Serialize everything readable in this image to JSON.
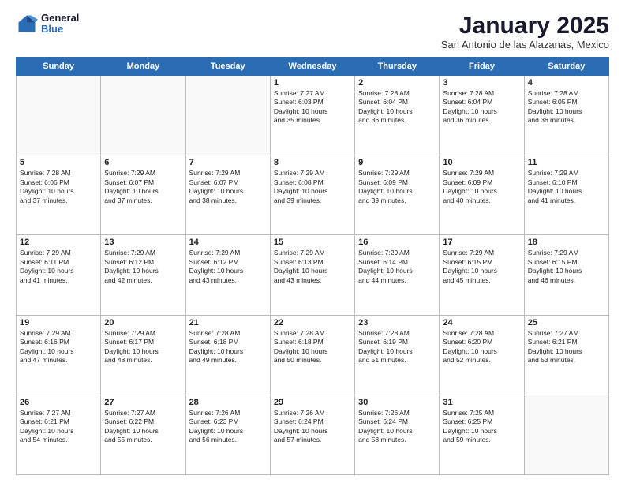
{
  "header": {
    "logo_general": "General",
    "logo_blue": "Blue",
    "month_title": "January 2025",
    "location": "San Antonio de las Alazanas, Mexico"
  },
  "weekdays": [
    "Sunday",
    "Monday",
    "Tuesday",
    "Wednesday",
    "Thursday",
    "Friday",
    "Saturday"
  ],
  "weeks": [
    [
      {
        "day": "",
        "info": ""
      },
      {
        "day": "",
        "info": ""
      },
      {
        "day": "",
        "info": ""
      },
      {
        "day": "1",
        "info": "Sunrise: 7:27 AM\nSunset: 6:03 PM\nDaylight: 10 hours\nand 35 minutes."
      },
      {
        "day": "2",
        "info": "Sunrise: 7:28 AM\nSunset: 6:04 PM\nDaylight: 10 hours\nand 36 minutes."
      },
      {
        "day": "3",
        "info": "Sunrise: 7:28 AM\nSunset: 6:04 PM\nDaylight: 10 hours\nand 36 minutes."
      },
      {
        "day": "4",
        "info": "Sunrise: 7:28 AM\nSunset: 6:05 PM\nDaylight: 10 hours\nand 36 minutes."
      }
    ],
    [
      {
        "day": "5",
        "info": "Sunrise: 7:28 AM\nSunset: 6:06 PM\nDaylight: 10 hours\nand 37 minutes."
      },
      {
        "day": "6",
        "info": "Sunrise: 7:29 AM\nSunset: 6:07 PM\nDaylight: 10 hours\nand 37 minutes."
      },
      {
        "day": "7",
        "info": "Sunrise: 7:29 AM\nSunset: 6:07 PM\nDaylight: 10 hours\nand 38 minutes."
      },
      {
        "day": "8",
        "info": "Sunrise: 7:29 AM\nSunset: 6:08 PM\nDaylight: 10 hours\nand 39 minutes."
      },
      {
        "day": "9",
        "info": "Sunrise: 7:29 AM\nSunset: 6:09 PM\nDaylight: 10 hours\nand 39 minutes."
      },
      {
        "day": "10",
        "info": "Sunrise: 7:29 AM\nSunset: 6:09 PM\nDaylight: 10 hours\nand 40 minutes."
      },
      {
        "day": "11",
        "info": "Sunrise: 7:29 AM\nSunset: 6:10 PM\nDaylight: 10 hours\nand 41 minutes."
      }
    ],
    [
      {
        "day": "12",
        "info": "Sunrise: 7:29 AM\nSunset: 6:11 PM\nDaylight: 10 hours\nand 41 minutes."
      },
      {
        "day": "13",
        "info": "Sunrise: 7:29 AM\nSunset: 6:12 PM\nDaylight: 10 hours\nand 42 minutes."
      },
      {
        "day": "14",
        "info": "Sunrise: 7:29 AM\nSunset: 6:12 PM\nDaylight: 10 hours\nand 43 minutes."
      },
      {
        "day": "15",
        "info": "Sunrise: 7:29 AM\nSunset: 6:13 PM\nDaylight: 10 hours\nand 43 minutes."
      },
      {
        "day": "16",
        "info": "Sunrise: 7:29 AM\nSunset: 6:14 PM\nDaylight: 10 hours\nand 44 minutes."
      },
      {
        "day": "17",
        "info": "Sunrise: 7:29 AM\nSunset: 6:15 PM\nDaylight: 10 hours\nand 45 minutes."
      },
      {
        "day": "18",
        "info": "Sunrise: 7:29 AM\nSunset: 6:15 PM\nDaylight: 10 hours\nand 46 minutes."
      }
    ],
    [
      {
        "day": "19",
        "info": "Sunrise: 7:29 AM\nSunset: 6:16 PM\nDaylight: 10 hours\nand 47 minutes."
      },
      {
        "day": "20",
        "info": "Sunrise: 7:29 AM\nSunset: 6:17 PM\nDaylight: 10 hours\nand 48 minutes."
      },
      {
        "day": "21",
        "info": "Sunrise: 7:28 AM\nSunset: 6:18 PM\nDaylight: 10 hours\nand 49 minutes."
      },
      {
        "day": "22",
        "info": "Sunrise: 7:28 AM\nSunset: 6:18 PM\nDaylight: 10 hours\nand 50 minutes."
      },
      {
        "day": "23",
        "info": "Sunrise: 7:28 AM\nSunset: 6:19 PM\nDaylight: 10 hours\nand 51 minutes."
      },
      {
        "day": "24",
        "info": "Sunrise: 7:28 AM\nSunset: 6:20 PM\nDaylight: 10 hours\nand 52 minutes."
      },
      {
        "day": "25",
        "info": "Sunrise: 7:27 AM\nSunset: 6:21 PM\nDaylight: 10 hours\nand 53 minutes."
      }
    ],
    [
      {
        "day": "26",
        "info": "Sunrise: 7:27 AM\nSunset: 6:21 PM\nDaylight: 10 hours\nand 54 minutes."
      },
      {
        "day": "27",
        "info": "Sunrise: 7:27 AM\nSunset: 6:22 PM\nDaylight: 10 hours\nand 55 minutes."
      },
      {
        "day": "28",
        "info": "Sunrise: 7:26 AM\nSunset: 6:23 PM\nDaylight: 10 hours\nand 56 minutes."
      },
      {
        "day": "29",
        "info": "Sunrise: 7:26 AM\nSunset: 6:24 PM\nDaylight: 10 hours\nand 57 minutes."
      },
      {
        "day": "30",
        "info": "Sunrise: 7:26 AM\nSunset: 6:24 PM\nDaylight: 10 hours\nand 58 minutes."
      },
      {
        "day": "31",
        "info": "Sunrise: 7:25 AM\nSunset: 6:25 PM\nDaylight: 10 hours\nand 59 minutes."
      },
      {
        "day": "",
        "info": ""
      }
    ]
  ]
}
